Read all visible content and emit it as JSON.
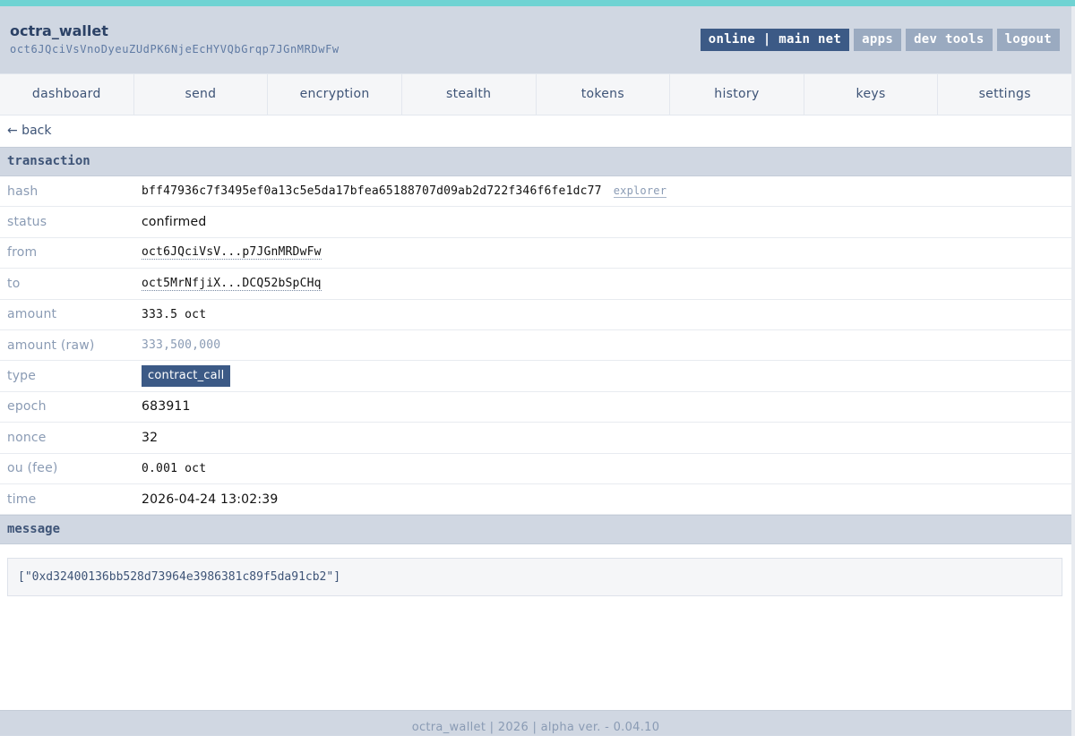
{
  "header": {
    "title": "octra_wallet",
    "address": "oct6JQciVsVnoDyeuZUdPK6NjeEcHYVQbGrqp7JGnMRDwFw",
    "network_status": "online | main net",
    "apps_label": "apps",
    "dev_tools_label": "dev tools",
    "logout_label": "logout"
  },
  "nav": {
    "items": [
      "dashboard",
      "send",
      "encryption",
      "stealth",
      "tokens",
      "history",
      "keys",
      "settings"
    ]
  },
  "back_label": "← back",
  "transaction": {
    "section_title": "transaction",
    "hash_label": "hash",
    "hash": "bff47936c7f3495ef0a13c5e5da17bfea65188707d09ab2d722f346f6fe1dc77",
    "explorer_label": "explorer",
    "status_label": "status",
    "status": "confirmed",
    "from_label": "from",
    "from": "oct6JQciVsV...p7JGnMRDwFw",
    "to_label": "to",
    "to": "oct5MrNfjiX...DCQ52bSpCHq",
    "amount_label": "amount",
    "amount": "333.5 oct",
    "amount_raw_label": "amount (raw)",
    "amount_raw": "333,500,000",
    "type_label": "type",
    "type": "contract_call",
    "epoch_label": "epoch",
    "epoch": "683911",
    "nonce_label": "nonce",
    "nonce": "32",
    "fee_label": "ou (fee)",
    "fee": "0.001 oct",
    "time_label": "time",
    "time": "2026-04-24 13:02:39"
  },
  "message": {
    "section_title": "message",
    "content": "[\"0xd32400136bb528d73964e3986381c89f5da91cb2\"]"
  },
  "footer": {
    "text": "octra_wallet | 2026 | alpha ver. - 0.04.10"
  },
  "colors": {
    "accent": "#6fd3d3",
    "header_bg": "#d0d7e2",
    "primary": "#3c5a86",
    "muted_button": "#9aaac0"
  }
}
